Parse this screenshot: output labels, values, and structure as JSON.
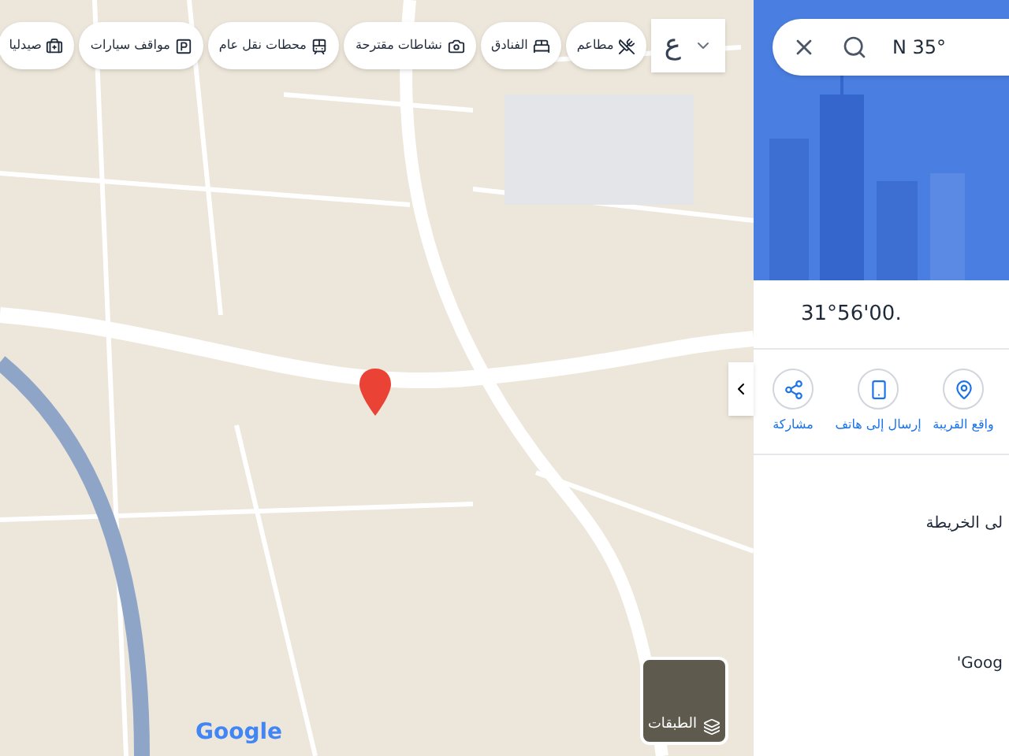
{
  "chips": [
    {
      "kind": "restaurant",
      "label": "مطاعم"
    },
    {
      "kind": "hotel",
      "label": "الفنادق"
    },
    {
      "kind": "camera",
      "label": "نشاطات مقترحة"
    },
    {
      "kind": "transit",
      "label": "محطات نقل عام"
    },
    {
      "kind": "parking",
      "label": "مواقف سيارات"
    },
    {
      "kind": "pharmacy",
      "label": "صيدليا"
    }
  ],
  "input_tools": {
    "label": "ع"
  },
  "map": {
    "logo": "Google",
    "layers": {
      "label": "الطبقات"
    }
  },
  "panel": {
    "search": {
      "value": "N 35°"
    },
    "coordinates": "31°56'00.",
    "actions": [
      {
        "kind": "nearby",
        "label": "واقع القريبة"
      },
      {
        "kind": "phone",
        "label": "إرسال إلى هاتف"
      },
      {
        "kind": "share",
        "label": "مشاركة"
      }
    ],
    "note": "لى الخريطة",
    "footer": "'Goog"
  }
}
